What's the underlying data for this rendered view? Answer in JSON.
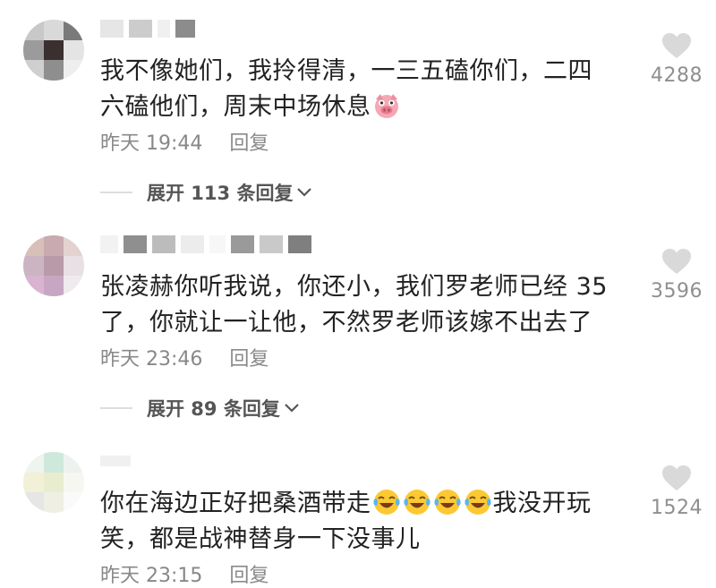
{
  "comments": [
    {
      "text_line1": "我不像她们，我拎得清，一三五磕你们，二四",
      "text_line2": "六磕他们，周末中场休息",
      "emoji": "pig-face-emoji",
      "time": "昨天 19:44",
      "reply_label": "回复",
      "likes": "4288",
      "expand_label": "展开 113 条回复"
    },
    {
      "text_line1": "张凌赫你听我说，你还小，我们罗老师已经 35",
      "text_line2": "了，你就让一让他，不然罗老师该嫁不出去了",
      "time": "昨天 23:46",
      "reply_label": "回复",
      "likes": "3596",
      "expand_label": "展开 89 条回复"
    },
    {
      "text_line1_a": "你在海边正好把桑酒带走",
      "text_line1_b": "我没开玩",
      "text_line2": "笑，都是战神替身一下没事儿",
      "emoji": "crying-laughing-emoji",
      "time": "昨天 23:15",
      "reply_label": "回复",
      "likes": "1524"
    }
  ],
  "colors": {
    "text": "#222222",
    "meta": "#888888",
    "heart": "#d9d9d9",
    "expand": "#555555"
  }
}
